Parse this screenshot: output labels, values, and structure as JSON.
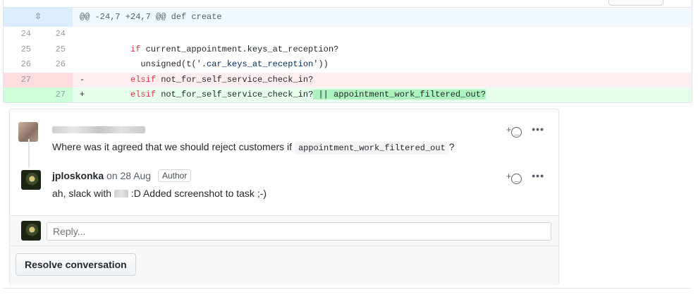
{
  "hunk": {
    "expand_icon": "unfold-icon",
    "header": "@@ -24,7 +24,7 @@ def create"
  },
  "lines": [
    {
      "old": "24",
      "new": "24",
      "type": "ctx",
      "code": ""
    },
    {
      "old": "25",
      "new": "25",
      "type": "ctx",
      "kw": "if",
      "code": " current_appointment.keys_at_reception?"
    },
    {
      "old": "26",
      "new": "26",
      "type": "ctx",
      "pre": "  unsigned(t(",
      "str": "'.car_keys_at_reception'",
      "post": "))"
    },
    {
      "old": "27",
      "new": "",
      "type": "del",
      "marker": "-",
      "kw": "elsif",
      "code": " not_for_self_service_check_in?"
    },
    {
      "old": "",
      "new": "27",
      "type": "add",
      "marker": "+",
      "kw": "elsif",
      "code": " not_for_self_service_check_in?",
      "hl": " || appointment_work_filtered_out?"
    }
  ],
  "comments": [
    {
      "body_pre": "Where was it agreed that we should reject customers if",
      "code": "appointment_work_filtered_out",
      "body_post": "?"
    },
    {
      "author": "jploskonka",
      "date": "on 28 Aug",
      "badge": "Author",
      "body_pre": "ah, slack with",
      "body_post": ":D Added screenshot to task ;-)"
    }
  ],
  "reaction": {
    "plus": "+",
    "icon": "smiley-icon"
  },
  "more_label": "•••",
  "reply": {
    "placeholder": "Reply..."
  },
  "resolve_label": "Resolve conversation"
}
